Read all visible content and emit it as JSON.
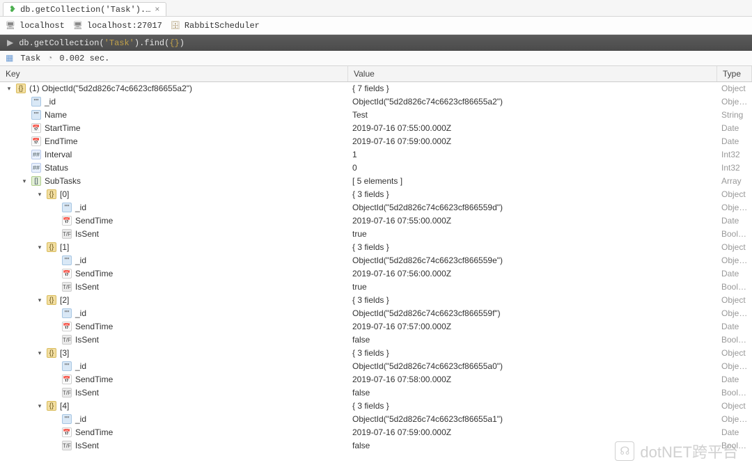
{
  "tab": {
    "title": "db.getCollection('Task').…"
  },
  "breadcrumbs": {
    "host": "localhost",
    "hostport": "localhost:27017",
    "db": "RabbitScheduler"
  },
  "query": {
    "prefix": "db.",
    "method": "getCollection(",
    "coll": "'Task'",
    "after": ").find(",
    "braces": "{}",
    "end": ")"
  },
  "status": {
    "coll": "Task",
    "time": "0.002 sec."
  },
  "headers": {
    "key": "Key",
    "value": "Value",
    "type": "Type"
  },
  "rows": [
    {
      "depth": 0,
      "caret": "▾",
      "icon": "obj",
      "key": "(1) ObjectId(\"5d2d826c74c6623cf86655a2\")",
      "value": "{ 7 fields }",
      "type": "Object"
    },
    {
      "depth": 1,
      "caret": "",
      "icon": "txt",
      "key": "_id",
      "value": "ObjectId(\"5d2d826c74c6623cf86655a2\")",
      "type": "ObjectId"
    },
    {
      "depth": 1,
      "caret": "",
      "icon": "txt",
      "key": "Name",
      "value": "Test",
      "type": "String"
    },
    {
      "depth": 1,
      "caret": "",
      "icon": "date",
      "key": "StartTime",
      "value": "2019-07-16 07:55:00.000Z",
      "type": "Date"
    },
    {
      "depth": 1,
      "caret": "",
      "icon": "date",
      "key": "EndTime",
      "value": "2019-07-16 07:59:00.000Z",
      "type": "Date"
    },
    {
      "depth": 1,
      "caret": "",
      "icon": "int",
      "key": "Interval",
      "value": "1",
      "type": "Int32"
    },
    {
      "depth": 1,
      "caret": "",
      "icon": "int",
      "key": "Status",
      "value": "0",
      "type": "Int32"
    },
    {
      "depth": 1,
      "caret": "▾",
      "icon": "arr",
      "key": "SubTasks",
      "value": "[ 5 elements ]",
      "type": "Array"
    },
    {
      "depth": 2,
      "caret": "▾",
      "icon": "obj",
      "key": "[0]",
      "value": "{ 3 fields }",
      "type": "Object"
    },
    {
      "depth": 3,
      "caret": "",
      "icon": "txt",
      "key": "_id",
      "value": "ObjectId(\"5d2d826c74c6623cf866559d\")",
      "type": "ObjectId"
    },
    {
      "depth": 3,
      "caret": "",
      "icon": "date",
      "key": "SendTime",
      "value": "2019-07-16 07:55:00.000Z",
      "type": "Date"
    },
    {
      "depth": 3,
      "caret": "",
      "icon": "bool",
      "key": "IsSent",
      "value": "true",
      "type": "Boolean"
    },
    {
      "depth": 2,
      "caret": "▾",
      "icon": "obj",
      "key": "[1]",
      "value": "{ 3 fields }",
      "type": "Object"
    },
    {
      "depth": 3,
      "caret": "",
      "icon": "txt",
      "key": "_id",
      "value": "ObjectId(\"5d2d826c74c6623cf866559e\")",
      "type": "ObjectId"
    },
    {
      "depth": 3,
      "caret": "",
      "icon": "date",
      "key": "SendTime",
      "value": "2019-07-16 07:56:00.000Z",
      "type": "Date"
    },
    {
      "depth": 3,
      "caret": "",
      "icon": "bool",
      "key": "IsSent",
      "value": "true",
      "type": "Boolean"
    },
    {
      "depth": 2,
      "caret": "▾",
      "icon": "obj",
      "key": "[2]",
      "value": "{ 3 fields }",
      "type": "Object"
    },
    {
      "depth": 3,
      "caret": "",
      "icon": "txt",
      "key": "_id",
      "value": "ObjectId(\"5d2d826c74c6623cf866559f\")",
      "type": "ObjectId"
    },
    {
      "depth": 3,
      "caret": "",
      "icon": "date",
      "key": "SendTime",
      "value": "2019-07-16 07:57:00.000Z",
      "type": "Date"
    },
    {
      "depth": 3,
      "caret": "",
      "icon": "bool",
      "key": "IsSent",
      "value": "false",
      "type": "Boolean"
    },
    {
      "depth": 2,
      "caret": "▾",
      "icon": "obj",
      "key": "[3]",
      "value": "{ 3 fields }",
      "type": "Object"
    },
    {
      "depth": 3,
      "caret": "",
      "icon": "txt",
      "key": "_id",
      "value": "ObjectId(\"5d2d826c74c6623cf86655a0\")",
      "type": "ObjectId"
    },
    {
      "depth": 3,
      "caret": "",
      "icon": "date",
      "key": "SendTime",
      "value": "2019-07-16 07:58:00.000Z",
      "type": "Date"
    },
    {
      "depth": 3,
      "caret": "",
      "icon": "bool",
      "key": "IsSent",
      "value": "false",
      "type": "Boolean"
    },
    {
      "depth": 2,
      "caret": "▾",
      "icon": "obj",
      "key": "[4]",
      "value": "{ 3 fields }",
      "type": "Object"
    },
    {
      "depth": 3,
      "caret": "",
      "icon": "txt",
      "key": "_id",
      "value": "ObjectId(\"5d2d826c74c6623cf86655a1\")",
      "type": "ObjectId"
    },
    {
      "depth": 3,
      "caret": "",
      "icon": "date",
      "key": "SendTime",
      "value": "2019-07-16 07:59:00.000Z",
      "type": "Date"
    },
    {
      "depth": 3,
      "caret": "",
      "icon": "bool",
      "key": "IsSent",
      "value": "false",
      "type": "Boolean"
    }
  ],
  "watermark": "dotNET跨平台"
}
